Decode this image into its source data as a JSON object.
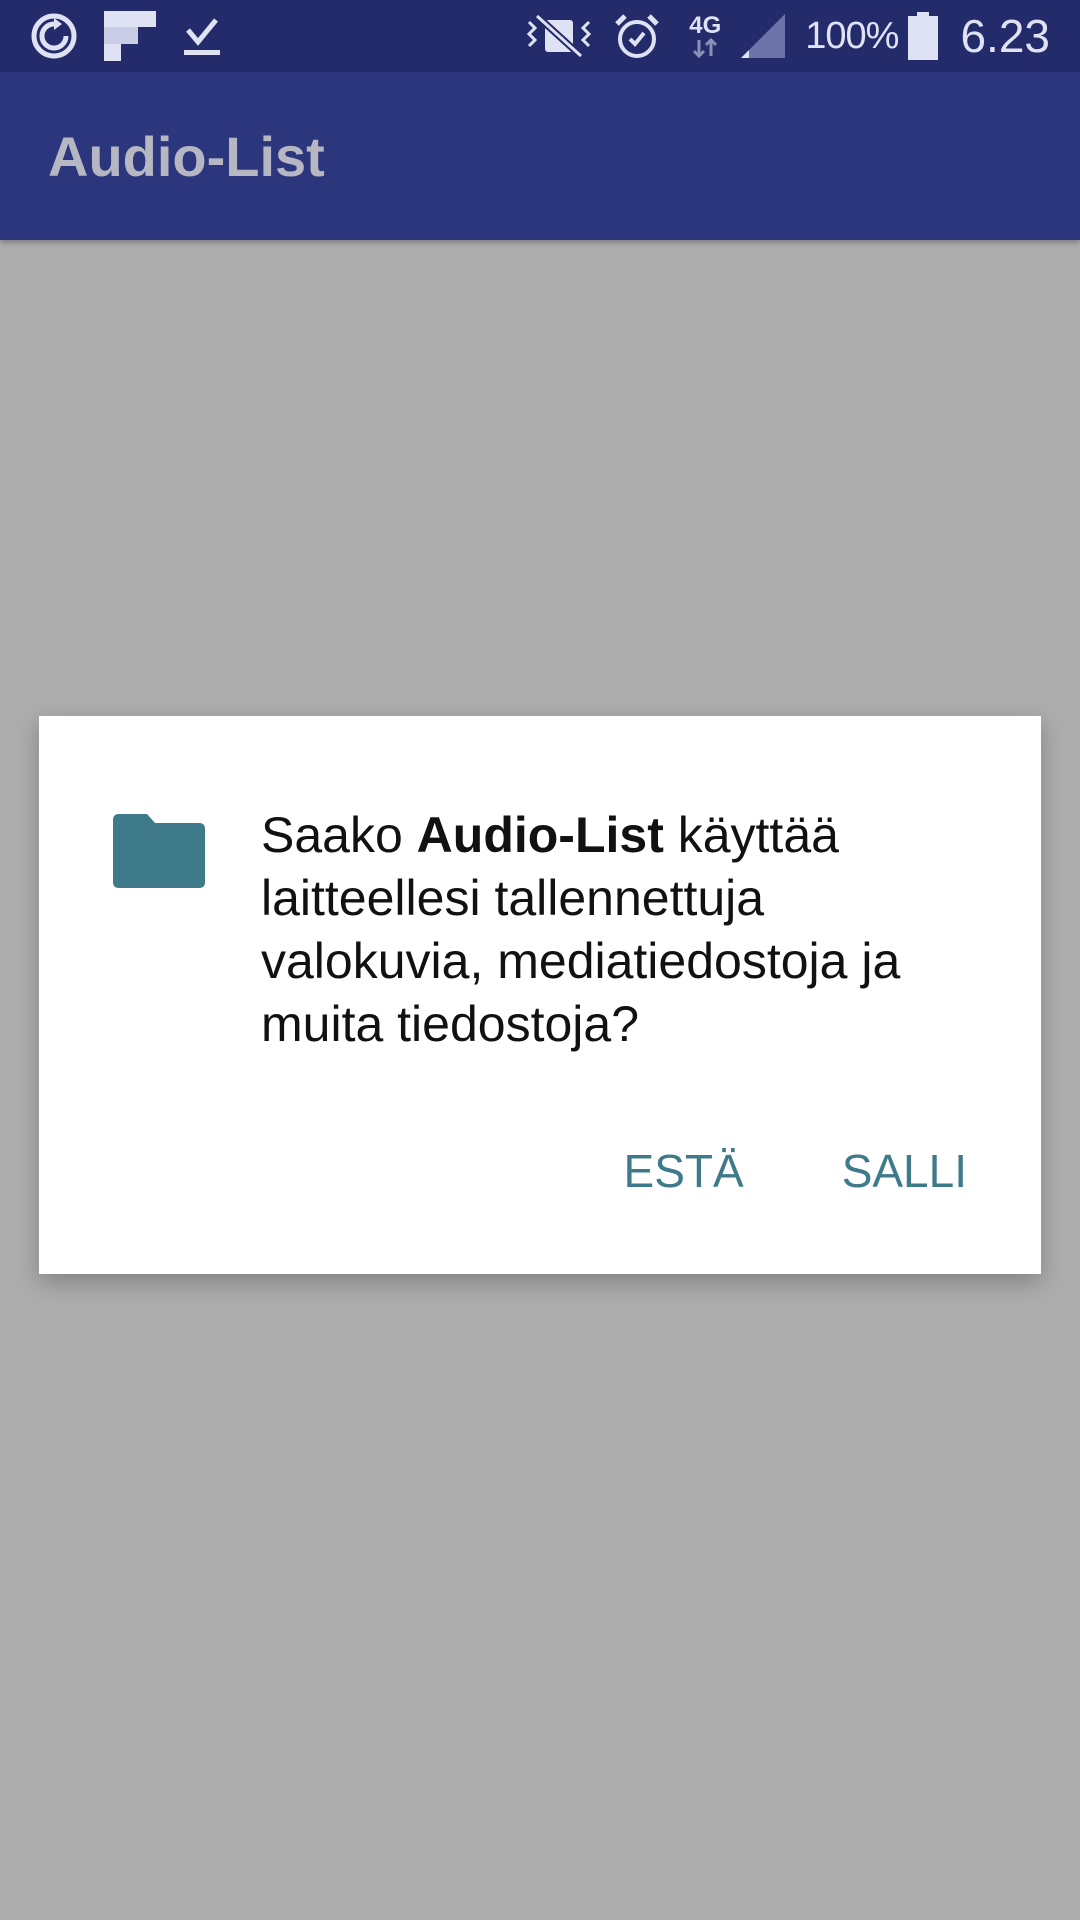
{
  "status_bar": {
    "network": "4G",
    "battery_percent": "100%",
    "time": "6.23",
    "icons": [
      "sync-icon",
      "flipboard-icon",
      "download-done-icon",
      "vibrate-off-icon",
      "alarm-icon",
      "data-arrows-icon",
      "signal-icon",
      "battery-icon"
    ]
  },
  "app_bar": {
    "title": "Audio-List"
  },
  "permission_dialog": {
    "icon": "folder-icon",
    "message_prefix": "Saako ",
    "app_name": "Audio-List",
    "message_suffix": " käyttää laitteellesi tallennettuja valokuvia, mediatiedostoja ja muita tiedostoja?",
    "deny_label": "ESTÄ",
    "allow_label": "SALLI",
    "accent_color": "#3e7a8a"
  },
  "colors": {
    "status_bar": "#232b6b",
    "app_bar": "#2c367c",
    "scrim": "#adadad"
  }
}
